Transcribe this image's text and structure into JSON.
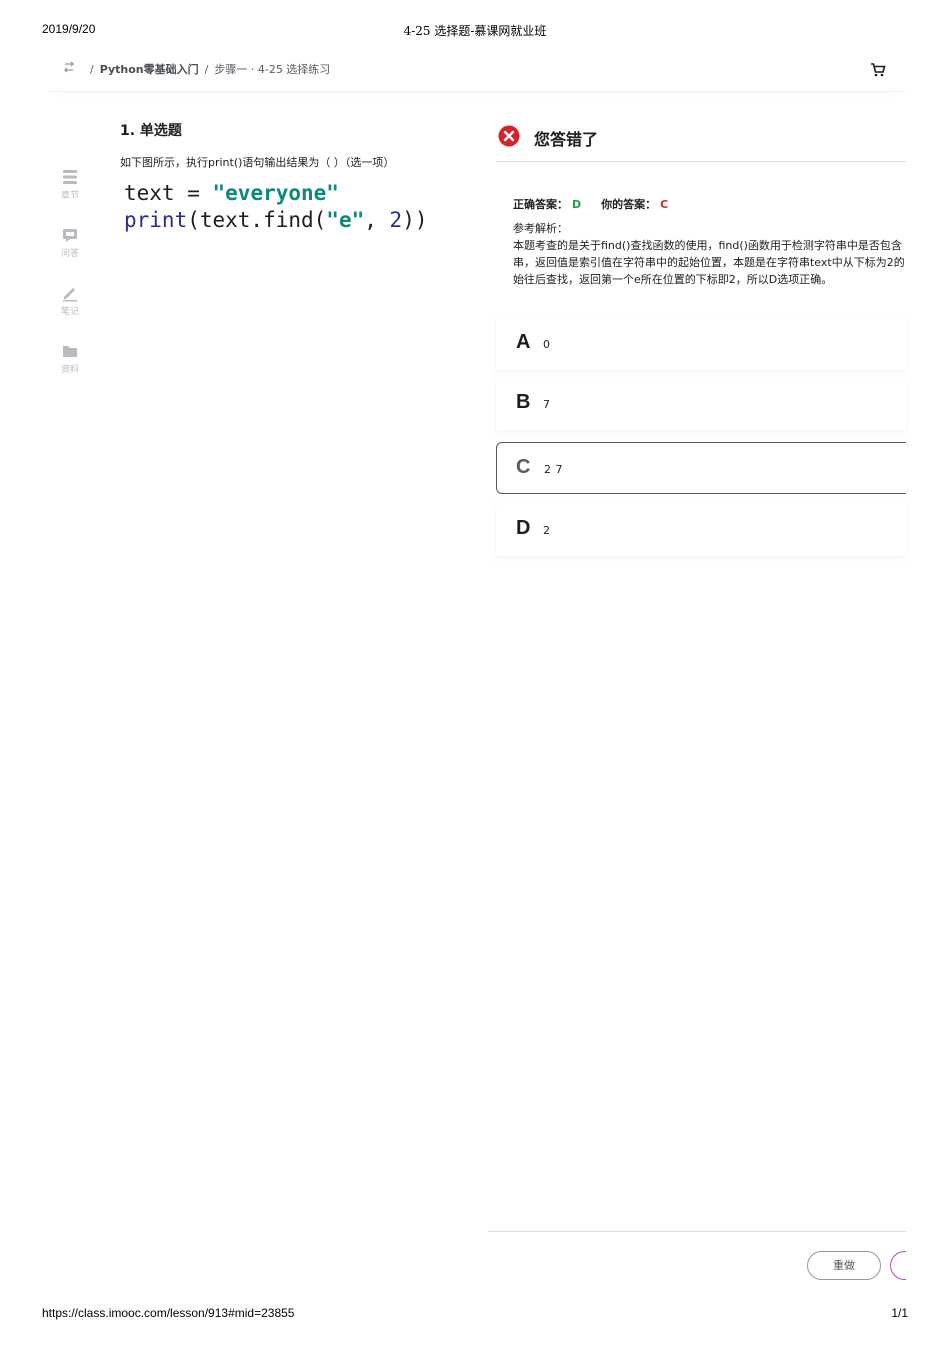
{
  "print": {
    "date": "2019/9/20",
    "doc_title": "4-25 选择题-慕课网就业班",
    "url": "https://class.imooc.com/lesson/913#mid=23855",
    "page": "1/1"
  },
  "header": {
    "switch_icon": "switch-icon",
    "sep": "/",
    "course": "Python零基础入门",
    "current": "步骤一 · 4-25 选择练习",
    "cart_icon": "cart-icon"
  },
  "sidebar": {
    "items": [
      {
        "label": "章节",
        "icon": "chapter-icon"
      },
      {
        "label": "问答",
        "icon": "qa-icon"
      },
      {
        "label": "笔记",
        "icon": "note-icon"
      },
      {
        "label": "资料",
        "icon": "folder-icon"
      }
    ]
  },
  "question": {
    "title": "1. 单选题",
    "text": "如下图所示，执行print()语句输出结果为（ ）（选一项）",
    "code": {
      "line1_var": "text",
      "line1_op": " = ",
      "line1_str": "\"everyone\"",
      "line2_fn": "print",
      "line2_a": "(text.find(",
      "line2_str": "\"e\"",
      "line2_comma": ", ",
      "line2_num": "2",
      "line2_end": "))"
    }
  },
  "result": {
    "status_icon": "wrong-icon",
    "status_text": "您答错了",
    "correct_label": "正确答案：",
    "correct_value": "D",
    "your_label": "你的答案：",
    "your_value": "C",
    "analysis_label": "参考解析：",
    "analysis_lines": [
      "本题考查的是关于find()查找函数的使用，find()函数用于检测字符串中是否包含",
      "串，返回值是索引值在字符串中的起始位置，本题是在字符串text中从下标为2的",
      "始往后查找，返回第一个e所在位置的下标即2，所以D选项正确。"
    ]
  },
  "options": [
    {
      "letter": "A",
      "value": "0"
    },
    {
      "letter": "B",
      "value": "7"
    },
    {
      "letter": "C",
      "value": "2  7"
    },
    {
      "letter": "D",
      "value": "2"
    }
  ],
  "actions": {
    "redo_label": "重做"
  },
  "colors": {
    "correct": "#1a9f4a",
    "wrong": "#d5232b",
    "next_accent": "#b14ac4"
  }
}
